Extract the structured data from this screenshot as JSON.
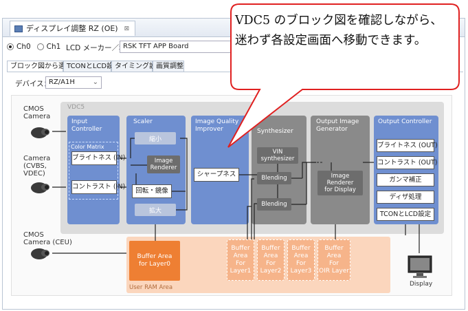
{
  "window": {
    "tab_title": "ディスプレイ調整 RZ (OE)",
    "close_glyph": "⊠"
  },
  "toolbar": {
    "ch0_label": "Ch0",
    "ch1_label": "Ch1",
    "lcd_label": "LCD メーカー／種類：",
    "lcd_value": "RSK TFT APP Board"
  },
  "subtabs": [
    {
      "label": "ブロック図から選択",
      "active": true
    },
    {
      "label": "TCONとLCD設定",
      "active": false
    },
    {
      "label": "タイミング設定",
      "active": false
    },
    {
      "label": "画質調整",
      "active": false
    }
  ],
  "device": {
    "label": "デバイス：",
    "value": "RZ/A1H",
    "arrow": "⌄"
  },
  "diagram": {
    "vdc_title": "VDC5",
    "inputs": {
      "cmos_camera": "CMOS\nCamera",
      "camera": "Camera\n(CVBS,\nVDEC)",
      "cmos_camera_ceu": "CMOS\nCamera (CEU)"
    },
    "input_controller": {
      "title": "Input\nController",
      "color_matrix": "Color Matrix",
      "brightness_in": "ブライトネス (IN)",
      "contrast_in": "コントラスト (IN)"
    },
    "scaler": {
      "title": "Scaler",
      "shrink": "縮小",
      "image_renderer": "Image\nRenderer",
      "rotate": "回転・鏡像",
      "enlarge": "拡大"
    },
    "iqi": {
      "title": "Image Quality\nImprover",
      "sharpness": "シャープネス"
    },
    "synth": {
      "title": "Synthesizer",
      "vin": "VIN\nsynthesizer",
      "blending1": "Blending",
      "blending2": "Blending"
    },
    "oig": {
      "title": "Output Image\nGenerator",
      "renderer": "Image\nRenderer\nfor Display"
    },
    "output_controller": {
      "title": "Output Controller",
      "buttons": [
        "ブライトネス (OUT)",
        "コントラスト (OUT)",
        "ガンマ補正",
        "ディザ処理",
        "TCONとLCD設定"
      ]
    },
    "ram": {
      "area_label": "User RAM Area",
      "buffer_layer0": "Buffer Area\nfor Layer0",
      "buffers": [
        "Buffer\nArea\nFor\nLayer1",
        "Buffer\nArea\nFor\nLayer2",
        "Buffer\nArea\nFor\nLayer3",
        "Buffer\nArea\nFor\nOIR Layer"
      ]
    },
    "display_label": "Display"
  },
  "callout": {
    "text": "VDC5 のブロック図を確認しながら、迷わず各設定画面へ移動できます。",
    "border_color": "#e02020"
  }
}
